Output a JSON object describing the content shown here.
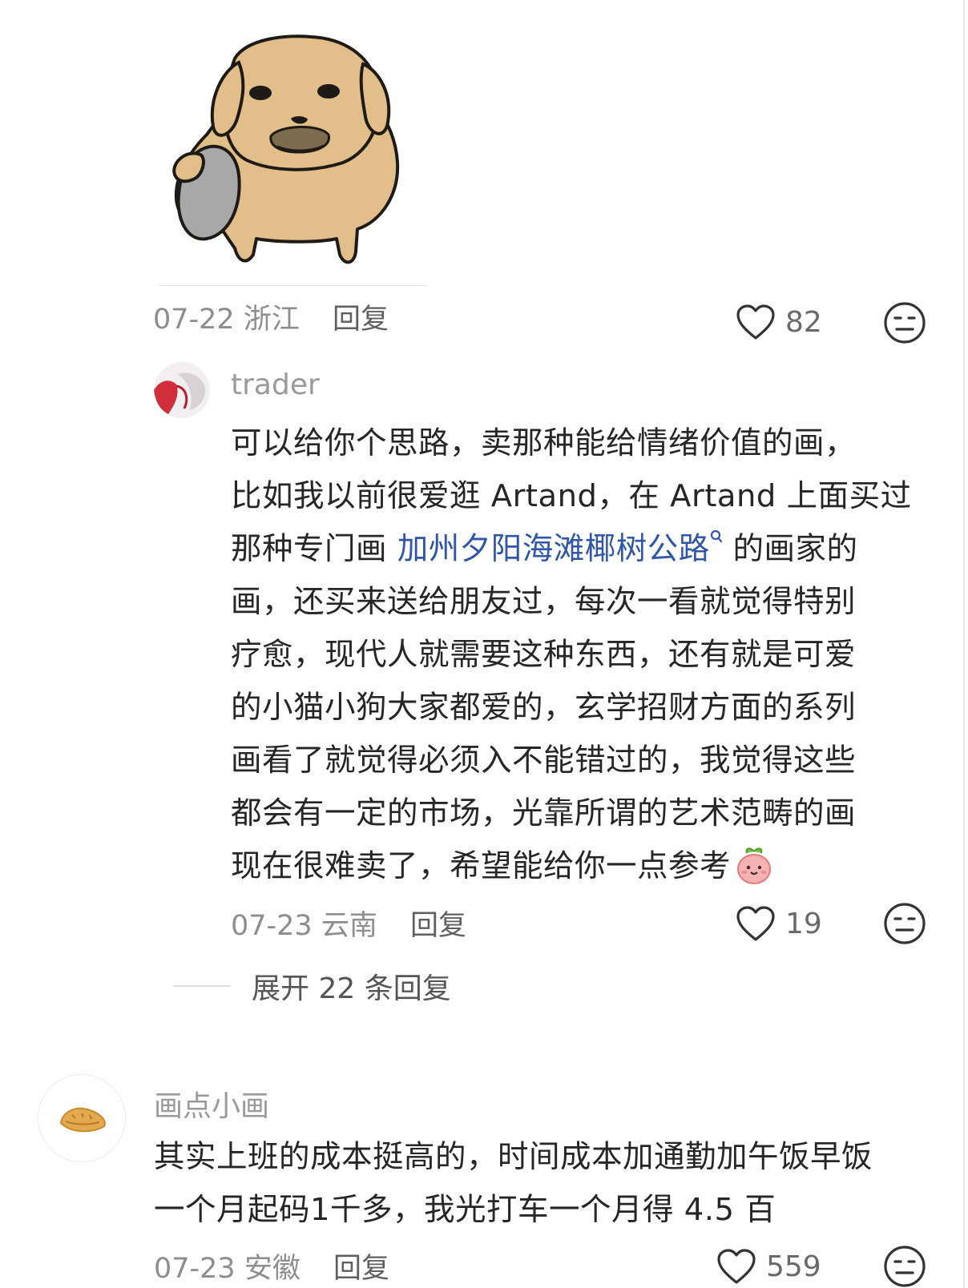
{
  "comment_1": {
    "meta": {
      "date": "07-22",
      "location": "浙江",
      "reply_label": "回复"
    },
    "likes": "82"
  },
  "reply_1": {
    "username": "trader",
    "text": {
      "l1": "可以给你个思路，卖那种能给情绪价值的画，",
      "l2": "比如我以前很爱逛 Artand，在 Artand 上面买过",
      "l3_pre": "那种专门画 ",
      "l3_link": "加州夕阳海滩椰树公路",
      "l3_post": " 的画家的",
      "l4": "画，还买来送给朋友过，每次一看就觉得特别",
      "l5": "疗愈，现代人就需要这种东西，还有就是可爱",
      "l6": "的小猫小狗大家都爱的，玄学招财方面的系列",
      "l7": "画看了就觉得必须入不能错过的，我觉得这些",
      "l8": "都会有一定的市场，光靠所谓的艺术范畴的画",
      "l9": "现在很难卖了，希望能给你一点参考"
    },
    "meta": {
      "date": "07-23",
      "location": "云南",
      "reply_label": "回复"
    },
    "likes": "19"
  },
  "expand_replies": "展开 22 条回复",
  "comment_2": {
    "username": "画点小画",
    "text": {
      "l1": "其实上班的成本挺高的，时间成本加通勤加午饭早饭",
      "l2": "一个月起码1千多，我光打车一个月得 4.5 百"
    },
    "meta": {
      "date": "07-23",
      "location": "安徽",
      "reply_label": "回复"
    },
    "likes": "559"
  },
  "icons": [
    "dog-sticker",
    "heart-icon",
    "dislike-face-icon",
    "search-icon",
    "peach-emoji"
  ],
  "colors": {
    "link": "#2f56a8",
    "meta": "#8e8e8e",
    "text": "#262626"
  }
}
